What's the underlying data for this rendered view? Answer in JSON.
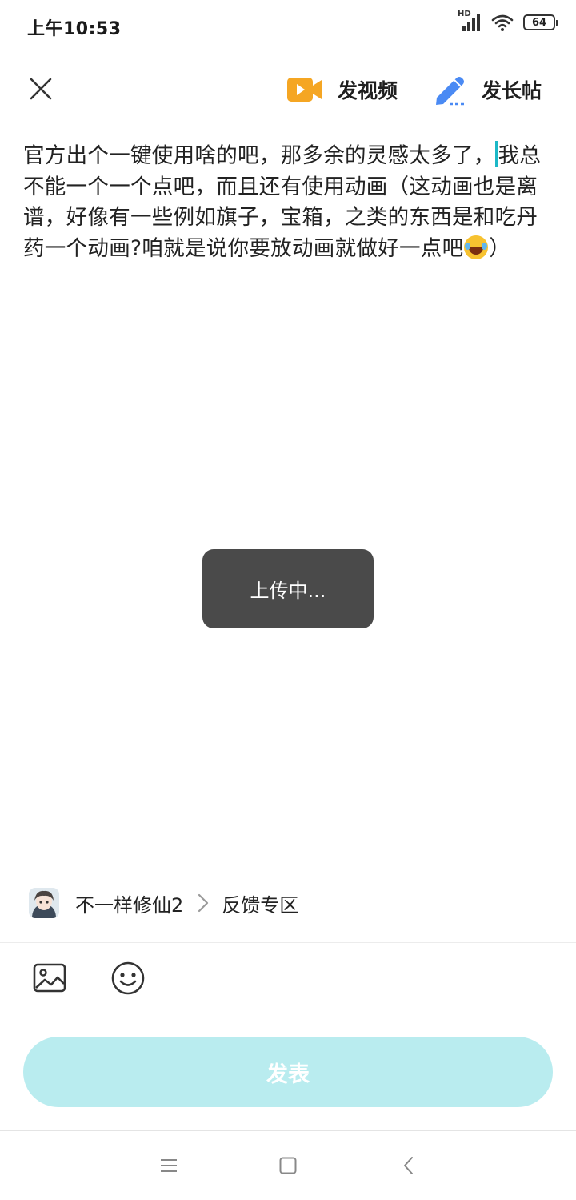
{
  "status_bar": {
    "time": "上午10:53",
    "network_label": "HD",
    "battery_level": "64",
    "icons": [
      "signal-icon",
      "wifi-icon",
      "battery-icon"
    ]
  },
  "top_bar": {
    "close_icon": "close-icon",
    "video_label": "发视频",
    "video_icon": "video-camera-icon",
    "long_post_label": "发长帖",
    "long_post_icon": "pen-icon",
    "video_icon_color": "#f5a623",
    "long_post_icon_color": "#4a8af4"
  },
  "editor": {
    "text_before_caret": "官方出个一键使用啥的吧，那多余的灵感太多了，",
    "text_after_caret": "我总不能一个一个点吧，而且还有使用动画（这动画也是离谱，好像有一些例如旗子，宝箱，之类的东西是和吃丹药一个动画?咱就是说你要放动画就做好一点吧",
    "emoji": "tears-of-joy-emoji",
    "text_end": "）",
    "caret_color": "#1cb8c7"
  },
  "toast": {
    "text": "上传中..."
  },
  "forum": {
    "avatar_icon": "forum-avatar",
    "name": "不一样修仙2",
    "chevron_icon": "chevron-right-icon",
    "section": "反馈专区"
  },
  "toolbar": {
    "image_icon": "image-icon",
    "emoji_icon": "emoji-icon"
  },
  "publish": {
    "label": "发表",
    "color": "#b9ecef"
  },
  "nav_bar": {
    "icons": [
      "menu-icon",
      "home-icon",
      "back-icon"
    ]
  }
}
